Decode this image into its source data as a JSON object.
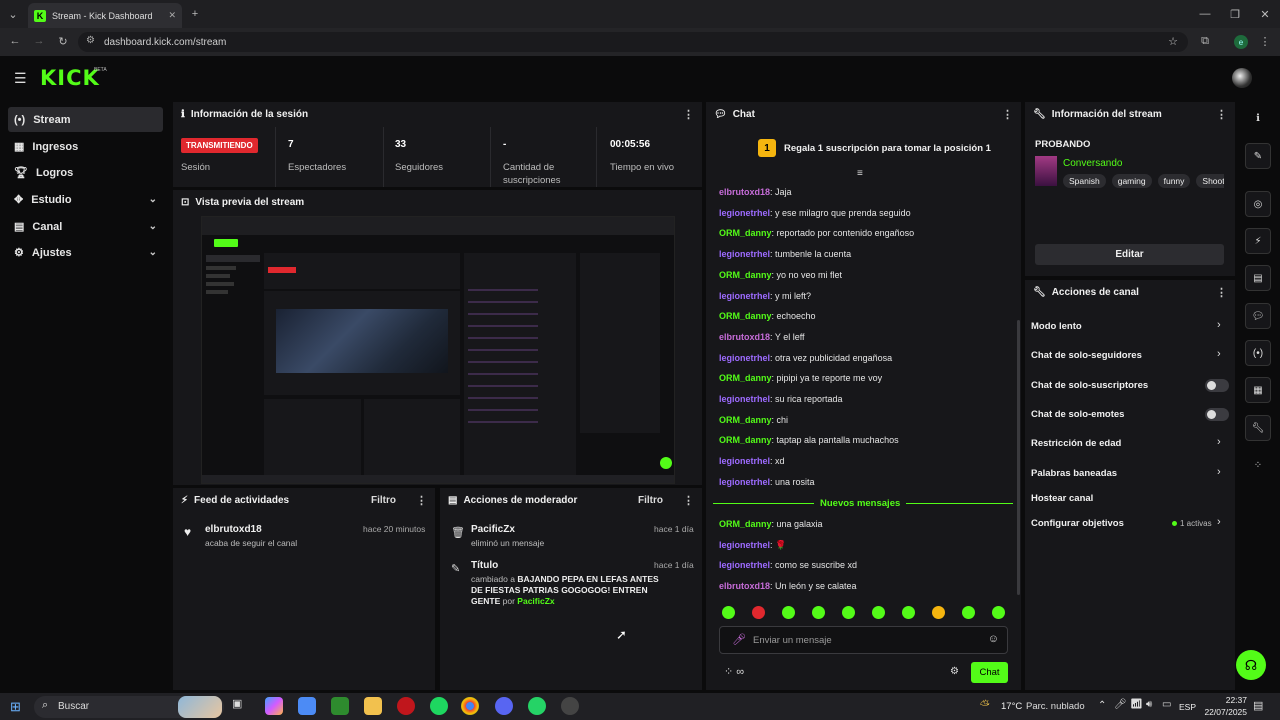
{
  "browser": {
    "tab_title": "Stream - Kick Dashboard",
    "url": "dashboard.kick.com/stream",
    "profile_initial": "e"
  },
  "header": {
    "logo": "KICK",
    "beta": "BETA"
  },
  "sidebar": {
    "items": [
      {
        "label": "Stream",
        "icon": "broadcast-icon"
      },
      {
        "label": "Ingresos",
        "icon": "revenue-icon"
      },
      {
        "label": "Logros",
        "icon": "trophy-icon"
      },
      {
        "label": "Estudio",
        "icon": "studio-icon"
      },
      {
        "label": "Canal",
        "icon": "channel-icon"
      },
      {
        "label": "Ajustes",
        "icon": "gear-icon"
      }
    ]
  },
  "session": {
    "title": "Información de la sesión",
    "status_badge": "TRANSMITIENDO",
    "status_label": "Sesión",
    "viewers_value": "7",
    "viewers_label": "Espectadores",
    "followers_value": "33",
    "followers_label": "Seguidores",
    "subs_value": "-",
    "subs_label": "Cantidad de suscripciones",
    "uptime_value": "00:05:56",
    "uptime_label": "Tiempo en vivo"
  },
  "preview": {
    "title": "Vista previa del stream"
  },
  "activity": {
    "title": "Feed de actividades",
    "filter": "Filtro",
    "items": [
      {
        "user": "elbrutoxd18",
        "text": "acaba de seguir el canal",
        "time": "hace 20 minutos"
      }
    ]
  },
  "modactions": {
    "title": "Acciones de moderador",
    "filter": "Filtro",
    "item1": {
      "user": "PacificZx",
      "text": "eliminó un mensaje",
      "time": "hace 1 día"
    },
    "item2": {
      "title": "Título",
      "prefix": "cambiado a ",
      "new_title": "BAJANDO PEPA EN LEFAS ANTES DE FIESTAS PATRIAS GOGOGOG! ENTREN GENTE",
      "by": " por ",
      "by_user": "PacificZx",
      "time": "hace 1 día"
    }
  },
  "chat": {
    "title": "Chat",
    "gift_banner": "Regala 1 suscripción para tomar la posición 1",
    "gift_rank": "1",
    "messages": [
      {
        "user": "elbrutoxd18",
        "text": ": Jaja"
      },
      {
        "user": "legionetrhel",
        "text": ": y ese milagro que prenda seguido"
      },
      {
        "user": "ORM_danny",
        "text": ": reportado por contenido engañoso"
      },
      {
        "user": "legionetrhel",
        "text": ": tumbenle la cuenta"
      },
      {
        "user": "ORM_danny",
        "text": ": yo no veo mi flet"
      },
      {
        "user": "legionetrhel",
        "text": ": y mi left?"
      },
      {
        "user": "ORM_danny",
        "text": ": echoecho"
      },
      {
        "user": "elbrutoxd18",
        "text": ": Y el leff"
      },
      {
        "user": "legionetrhel",
        "text": ": otra vez publicidad engañosa"
      },
      {
        "user": "ORM_danny",
        "text": ": pipipi ya te reporte me voy"
      },
      {
        "user": "legionetrhel",
        "text": ": su rica reportada"
      },
      {
        "user": "ORM_danny",
        "text": ": chi"
      },
      {
        "user": "ORM_danny",
        "text": ": taptap ala pantalla muchachos"
      },
      {
        "user": "legionetrhel",
        "text": ": xd"
      },
      {
        "user": "legionetrhel",
        "text": ": una rosita"
      }
    ],
    "new_messages_label": "Nuevos mensajes",
    "new_messages": [
      {
        "user": "ORM_danny",
        "text": ": una galaxia"
      },
      {
        "user": "legionetrhel",
        "text": ": 🌹"
      },
      {
        "user": "legionetrhel",
        "text": ": como se suscribe xd"
      },
      {
        "user": "elbrutoxd18",
        "text": ": Un león y se calatea"
      }
    ],
    "input_placeholder": "Enviar un mensaje",
    "send_label": "Chat"
  },
  "stream_info": {
    "title": "Información del stream",
    "stream_title": "PROBANDO",
    "category": "Conversando",
    "tags": [
      "Spanish",
      "gaming",
      "funny",
      "Shooter"
    ],
    "edit_label": "Editar"
  },
  "channel_actions": {
    "title": "Acciones de canal",
    "slow_mode": "Modo lento",
    "followers_only": "Chat de solo-seguidores",
    "subs_only": "Chat de solo-suscriptores",
    "emotes_only": "Chat de solo-emotes",
    "age_restriction": "Restricción de edad",
    "banned_words": "Palabras baneadas",
    "host": "Hostear canal",
    "goals": "Configurar objetivos",
    "goals_active": "1 activas"
  },
  "taskbar": {
    "search": "Buscar",
    "weather_temp": "17°C",
    "weather_text": "Parc. nublado",
    "lang": "ESP",
    "time": "22:37",
    "date": "22/07/2025"
  },
  "colors": {
    "accent": "#53fc18",
    "live": "#e0282e",
    "panel": "#17171a",
    "bg": "#0b0b0c"
  }
}
